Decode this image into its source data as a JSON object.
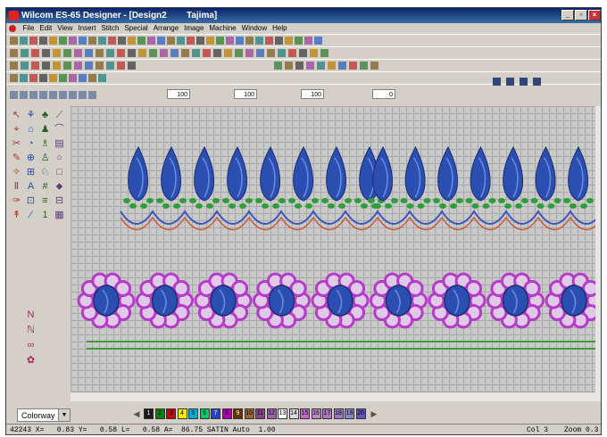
{
  "window": {
    "title": "Wilcom ES-65 Designer - [Design2        Tajima]",
    "buttons": [
      "minimize",
      "restore",
      "close"
    ]
  },
  "menu": [
    "File",
    "Edit",
    "View",
    "Insert",
    "Stitch",
    "Special",
    "Arrange",
    "Image",
    "Machine",
    "Window",
    "Help"
  ],
  "toolbars": {
    "row1_icon_count": 32,
    "row2_icon_count": 30,
    "row3_left_icon_count": 12,
    "row3_right_icon_count": 10,
    "row4": {
      "left_field_value": "",
      "right_field_value": "100",
      "fields": [
        "100",
        "100",
        "100",
        "0"
      ]
    }
  },
  "left_toolbar": {
    "tools": [
      "select-icon",
      "reshape-icon",
      "fill-icon",
      "run-icon",
      "outline-icon",
      "square-icon",
      "lettering-icon",
      "monogram-icon",
      "circle-icon",
      "stitch-icon",
      "hatch-icon",
      "rect-icon",
      "needle-icon",
      "text-icon",
      "number-icon",
      "scale-icon",
      "grid-icon",
      "split-icon",
      "line-icon",
      "feather-icon",
      "measure-icon",
      "bean-icon",
      "zigzag-icon",
      "arrow-icon",
      "shape-icon",
      "dot-icon",
      "curve-icon",
      "stitch-angle-icon",
      "satin-icon",
      "bead-icon",
      "swirl-icon",
      "flower-icon"
    ]
  },
  "canvas": {
    "leaf_colors": {
      "petal": "#2b4fb0",
      "leaf": "#2f9e3a",
      "line_blue": "#3c56b8",
      "line_red": "#c85b3c"
    },
    "flower_colors": {
      "ring": "#b43cc8",
      "center": "#2b4fb0",
      "line_green": "#3a9c3a"
    },
    "leaf_count": 15,
    "flower_count": 9
  },
  "bottom": {
    "colorway": "Colorway 1",
    "palette": [
      {
        "num": "1",
        "color": "#1a1a1a"
      },
      {
        "num": "2",
        "color": "#008800"
      },
      {
        "num": "3",
        "color": "#cc0000"
      },
      {
        "num": "4",
        "color": "#ffee00"
      },
      {
        "num": "5",
        "color": "#00aacc"
      },
      {
        "num": "6",
        "color": "#00cc66"
      },
      {
        "num": "7",
        "color": "#2244cc"
      },
      {
        "num": "8",
        "color": "#aa00aa"
      },
      {
        "num": "9",
        "color": "#663300"
      },
      {
        "num": "10",
        "color": "#996633"
      },
      {
        "num": "11",
        "color": "#884488"
      },
      {
        "num": "12",
        "color": "#9966aa"
      },
      {
        "num": "13",
        "color": "#ffffff"
      },
      {
        "num": "14",
        "color": "#dddddd"
      },
      {
        "num": "15",
        "color": "#cc66cc"
      },
      {
        "num": "16",
        "color": "#bb88cc"
      },
      {
        "num": "17",
        "color": "#aa77bb"
      },
      {
        "num": "18",
        "color": "#9977cc"
      },
      {
        "num": "19",
        "color": "#8888cc"
      },
      {
        "num": "20",
        "color": "#6655bb"
      }
    ]
  },
  "status": {
    "left": "42243 X=   0.83 Y=   0.58 L=   0.58 A=  86.75 SATIN Auto  1.00",
    "col": "Col 3",
    "zoom": "Zoom 0.3"
  }
}
